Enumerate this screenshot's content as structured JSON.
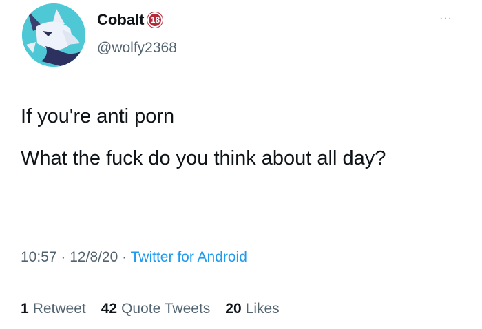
{
  "tweet": {
    "author": {
      "display_name": "Cobalt",
      "badge": "18",
      "handle": "@wolfy2368"
    },
    "more_icon": "···",
    "body": [
      "If you're anti porn",
      "What the fuck do you think about all day?"
    ],
    "meta": {
      "time": "10:57",
      "separator": "·",
      "date": "12/8/20",
      "source": "Twitter for Android"
    },
    "stats": [
      {
        "count": "1",
        "label": "Retweet"
      },
      {
        "count": "42",
        "label": "Quote Tweets"
      },
      {
        "count": "20",
        "label": "Likes"
      }
    ]
  },
  "colors": {
    "link": "#1d9bf0",
    "secondary_text": "#536471",
    "badge": "#b52a3a",
    "avatar_bg": "#4fc8d6"
  },
  "icons": {
    "avatar": "wolf-avatar-icon",
    "badge": "age-18-badge-icon",
    "more": "more-options-icon"
  }
}
